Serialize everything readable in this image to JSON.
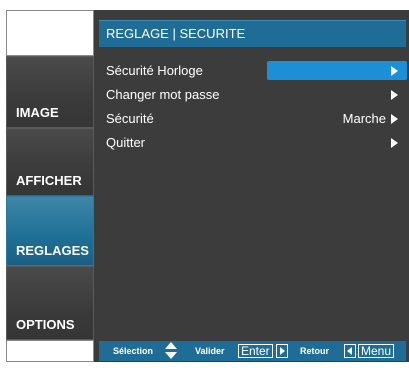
{
  "sidebar": {
    "tabs": [
      {
        "label": "IMAGE"
      },
      {
        "label": "AFFICHER"
      },
      {
        "label": "REGLAGES"
      },
      {
        "label": "OPTIONS"
      }
    ]
  },
  "menu": {
    "title": "REGLAGE | SECURITE",
    "items": [
      {
        "label": "Sécurité Horloge",
        "value": ""
      },
      {
        "label": "Changer mot passe",
        "value": ""
      },
      {
        "label": "Sécurité",
        "value": "Marche"
      },
      {
        "label": "Quitter",
        "value": ""
      }
    ]
  },
  "footer": {
    "selection": "Sélection",
    "valider": "Valider",
    "enter_key": "Enter",
    "retour": "Retour",
    "menu_key": "Menu"
  },
  "colors": {
    "accent": "#1f6d97",
    "highlight": "#1c8fd6",
    "panel": "#3c3c3c"
  },
  "icons": [
    "arrow-right-icon",
    "up-down-arrows-icon"
  ]
}
